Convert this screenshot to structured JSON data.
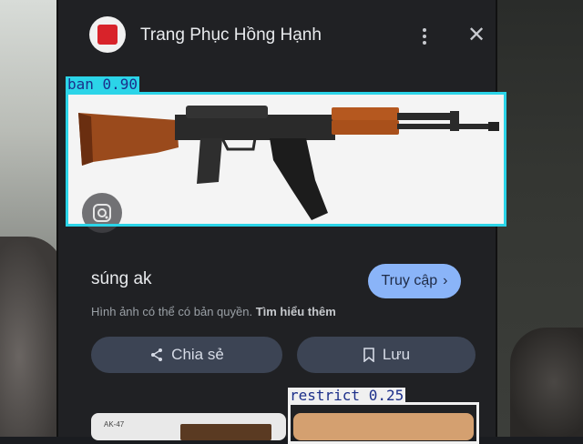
{
  "header": {
    "site_name": "Trang Phục Hồng Hạnh",
    "favicon_color": "#d8232a"
  },
  "result": {
    "title": "súng ak",
    "visit_label": "Truy cập",
    "copyright_text": "Hình ảnh có thể có bản quyền.",
    "learn_more": "Tìm hiểu thêm"
  },
  "actions": {
    "share_label": "Chia sẻ",
    "save_label": "Lưu"
  },
  "annotations": [
    {
      "label": "ban 0.90",
      "color": "#2bd4e8"
    },
    {
      "label": "restrict 0.25",
      "color": "#f0f0f0"
    }
  ],
  "thumbnails": {
    "first_caption": "AK-47"
  }
}
